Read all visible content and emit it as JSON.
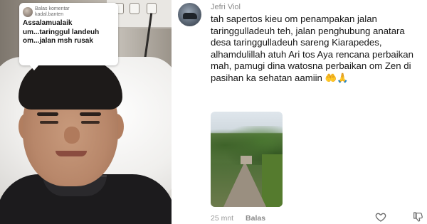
{
  "video": {
    "reply_bubble": {
      "meta_line1": "Balas komentar",
      "meta_line2": "kadal.banten",
      "text": "Assalamualaik um...taringgul landeuh om...jalan msh rusak"
    }
  },
  "comment": {
    "username": "Jefri Viol",
    "body": "tah sapertos kieu om penampakan jalan taringgulladeuh teh, jalan penghubung anatara desa taringgulladeuh sareng Kiarapedes,\nalhamdulillah atuh Ari tos Aya rencana perbaikan mah, pamugi dina watosna perbaikan om Zen di pasihan ka sehatan aamiin 🤲🙏",
    "time": "25 mnt",
    "reply_label": "Balas",
    "icons": {
      "like": "heart-icon",
      "dislike": "thumbs-down-icon"
    }
  }
}
